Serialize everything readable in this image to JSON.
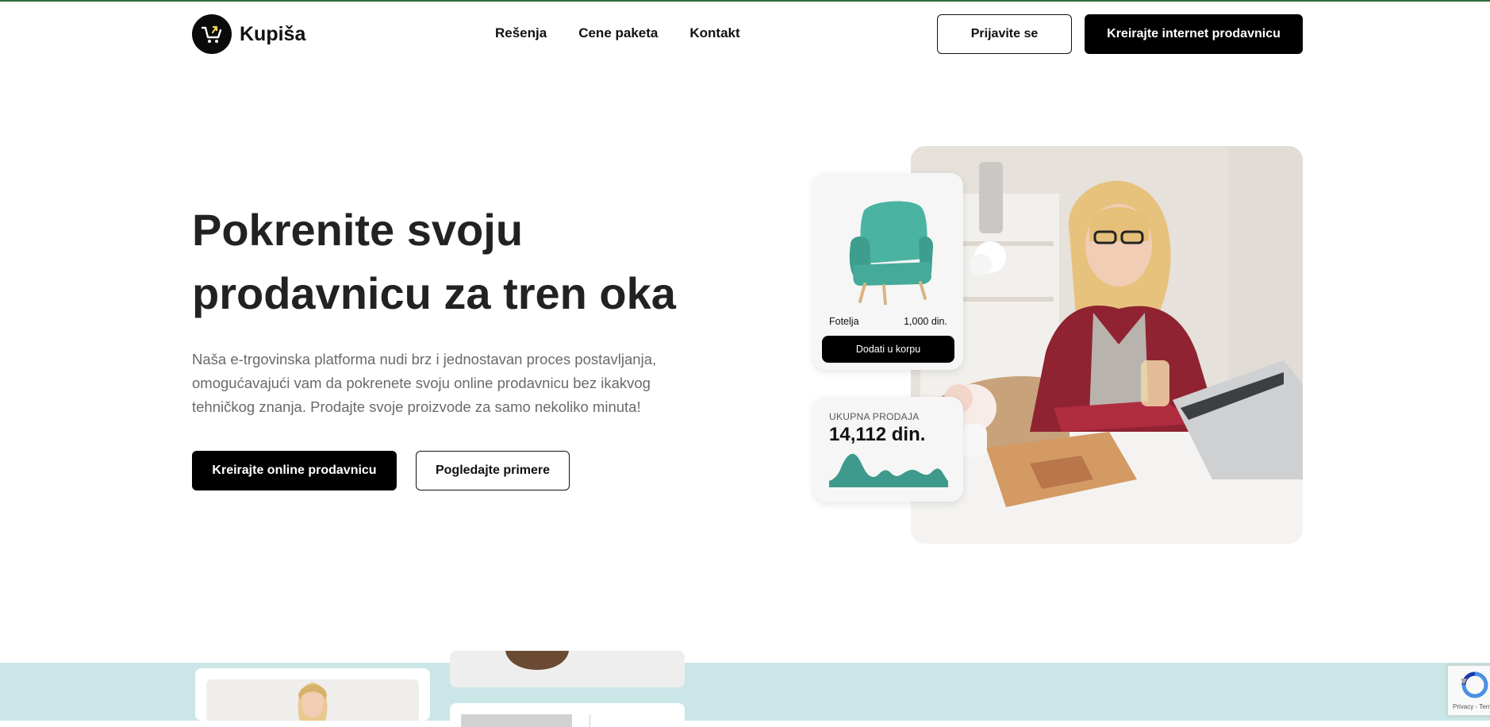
{
  "brand": {
    "name": "Kupiša"
  },
  "nav": {
    "items": [
      "Rešenja",
      "Cene paketa",
      "Kontakt"
    ]
  },
  "header": {
    "login_label": "Prijavite se",
    "create_label": "Kreirajte internet prodavnicu"
  },
  "hero": {
    "title_line1": "Pokrenite svoju",
    "title_line2": "prodavnicu za tren oka",
    "description": "Naša e-trgovinska platforma nudi brz i jednostavan proces postavljanja, omogućavajući vam da pokrenete svoju online prodavnicu bez ikakvog tehničkog znanja. Prodajte svoje proizvode za samo nekoliko minuta!",
    "primary_cta": "Kreirajte online prodavnicu",
    "secondary_cta": "Pogledajte primere"
  },
  "product_card": {
    "name": "Fotelja",
    "price": "1,000 din.",
    "button": "Dodati u korpu"
  },
  "sales_card": {
    "label": "UKUPNA PRODAJA",
    "value": "14,112 din."
  },
  "recaptcha": {
    "text": "Privacy - Terms"
  },
  "colors": {
    "accent_teal": "#3e9a8c",
    "band_bg": "#cbe6e6",
    "dark": "#000000"
  },
  "icons": {
    "logo": "shopping-cart-icon"
  }
}
